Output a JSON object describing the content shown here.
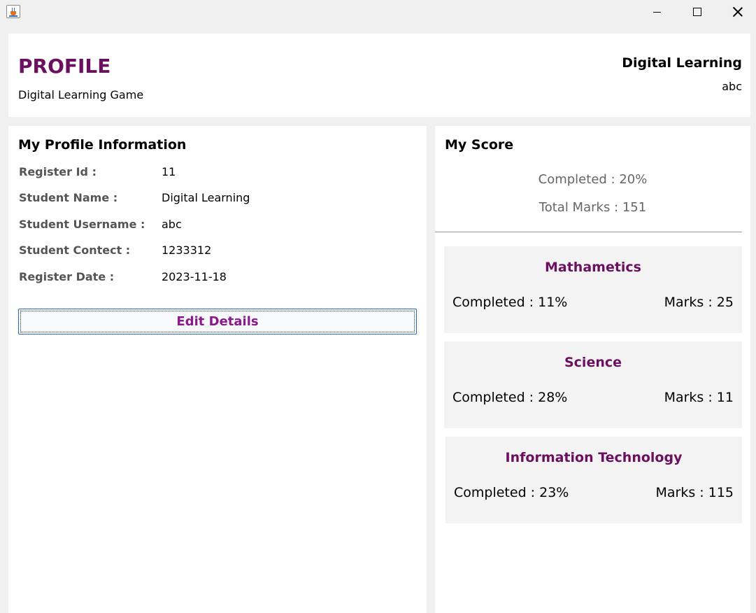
{
  "window": {
    "icon": "java-cup-icon"
  },
  "header": {
    "title": "PROFILE",
    "subtitle": "Digital Learning Game",
    "user_name": "Digital Learning",
    "user_handle": "abc"
  },
  "profile": {
    "heading": "My Profile Information",
    "fields": [
      {
        "label": "Register Id :",
        "value": "11"
      },
      {
        "label": "Student Name :",
        "value": "Digital Learning"
      },
      {
        "label": "Student Username :",
        "value": "abc"
      },
      {
        "label": "Student Contect :",
        "value": "1233312"
      },
      {
        "label": "Register Date :",
        "value": "2023-11-18"
      }
    ],
    "edit_button": "Edit Details"
  },
  "score": {
    "heading": "My Score",
    "completed": "Completed : 20%",
    "total_marks": "Total Marks : 151",
    "subjects": [
      {
        "name": "Mathametics",
        "completed": "Completed : 11%",
        "marks": "Marks : 25"
      },
      {
        "name": "Science",
        "completed": "Completed : 28%",
        "marks": "Marks : 11"
      },
      {
        "name": "Information Technology",
        "completed": "Completed : 23%",
        "marks": "Marks : 115"
      }
    ]
  },
  "colors": {
    "accent": "#6b1060",
    "button_text": "#8a1a8a",
    "card_bg": "#f3f3f3"
  }
}
